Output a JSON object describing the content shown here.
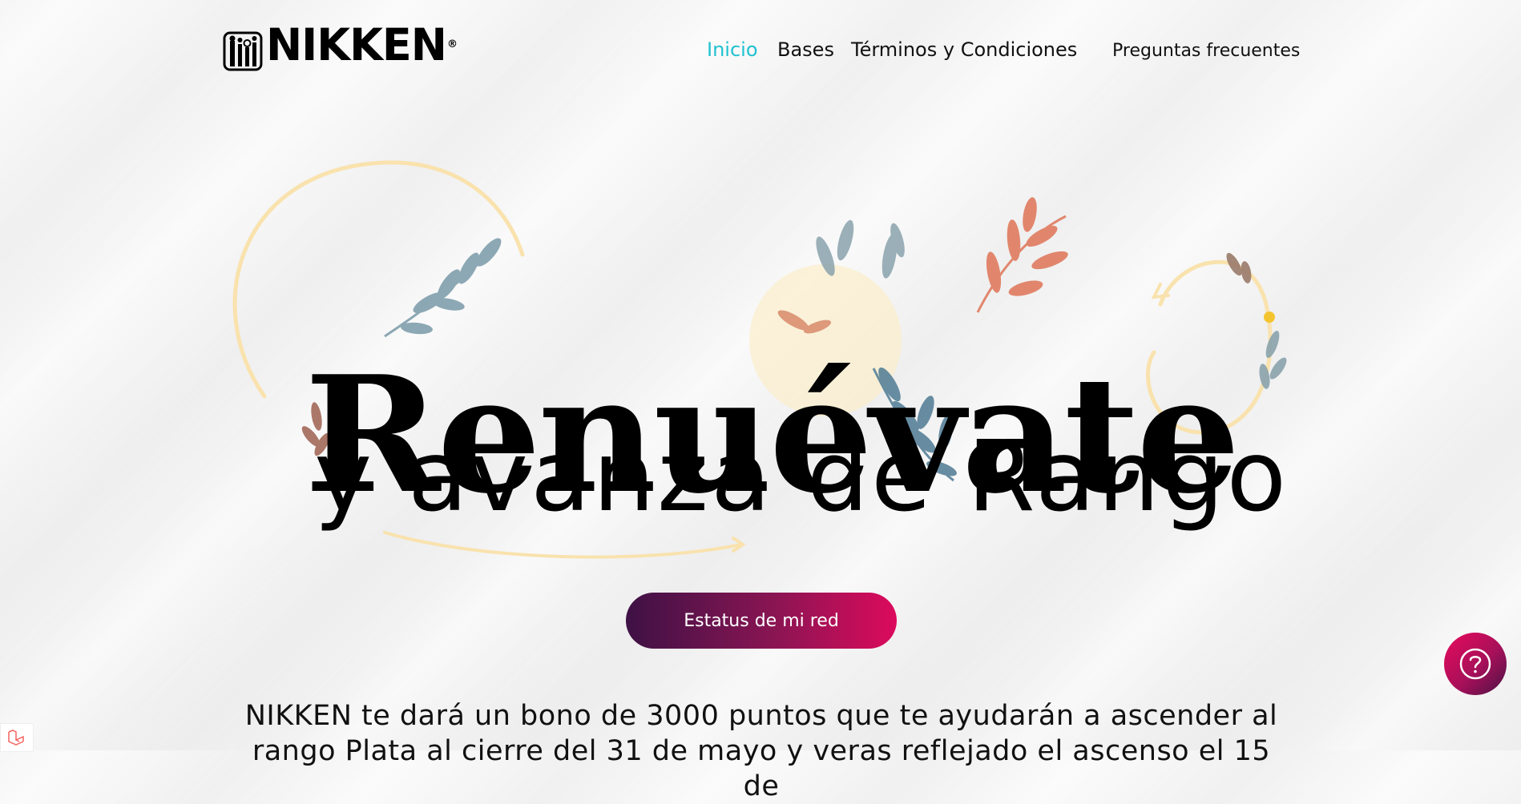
{
  "brand": {
    "name": "NIKKEN",
    "registered": "®"
  },
  "nav": {
    "items": [
      {
        "label": "Inicio",
        "active": true
      },
      {
        "label": "Bases",
        "active": false
      },
      {
        "label": "Términos y Condiciones",
        "active": false
      },
      {
        "label": "Preguntas frecuentes",
        "active": false
      }
    ]
  },
  "hero": {
    "headline": "Renuévate",
    "subheadline": "y avanza de Rango",
    "cta_label": "Estatus de mi red"
  },
  "intro": {
    "text": "NIKKEN te dará un bono de 3000 puntos que te ayudarán a ascender al rango Plata al cierre del 31 de mayo y veras reflejado el ascenso el 15 de"
  },
  "help_button": {
    "icon": "question-circle-icon"
  },
  "colors": {
    "active_link": "#1fc1d1",
    "cta_gradient_start": "#3e1145",
    "cta_gradient_end": "#dc0a5c",
    "accent_yellow": "#f7dc9a",
    "leaf_blue": "#6b8fa3",
    "leaf_coral": "#e07b5f"
  }
}
